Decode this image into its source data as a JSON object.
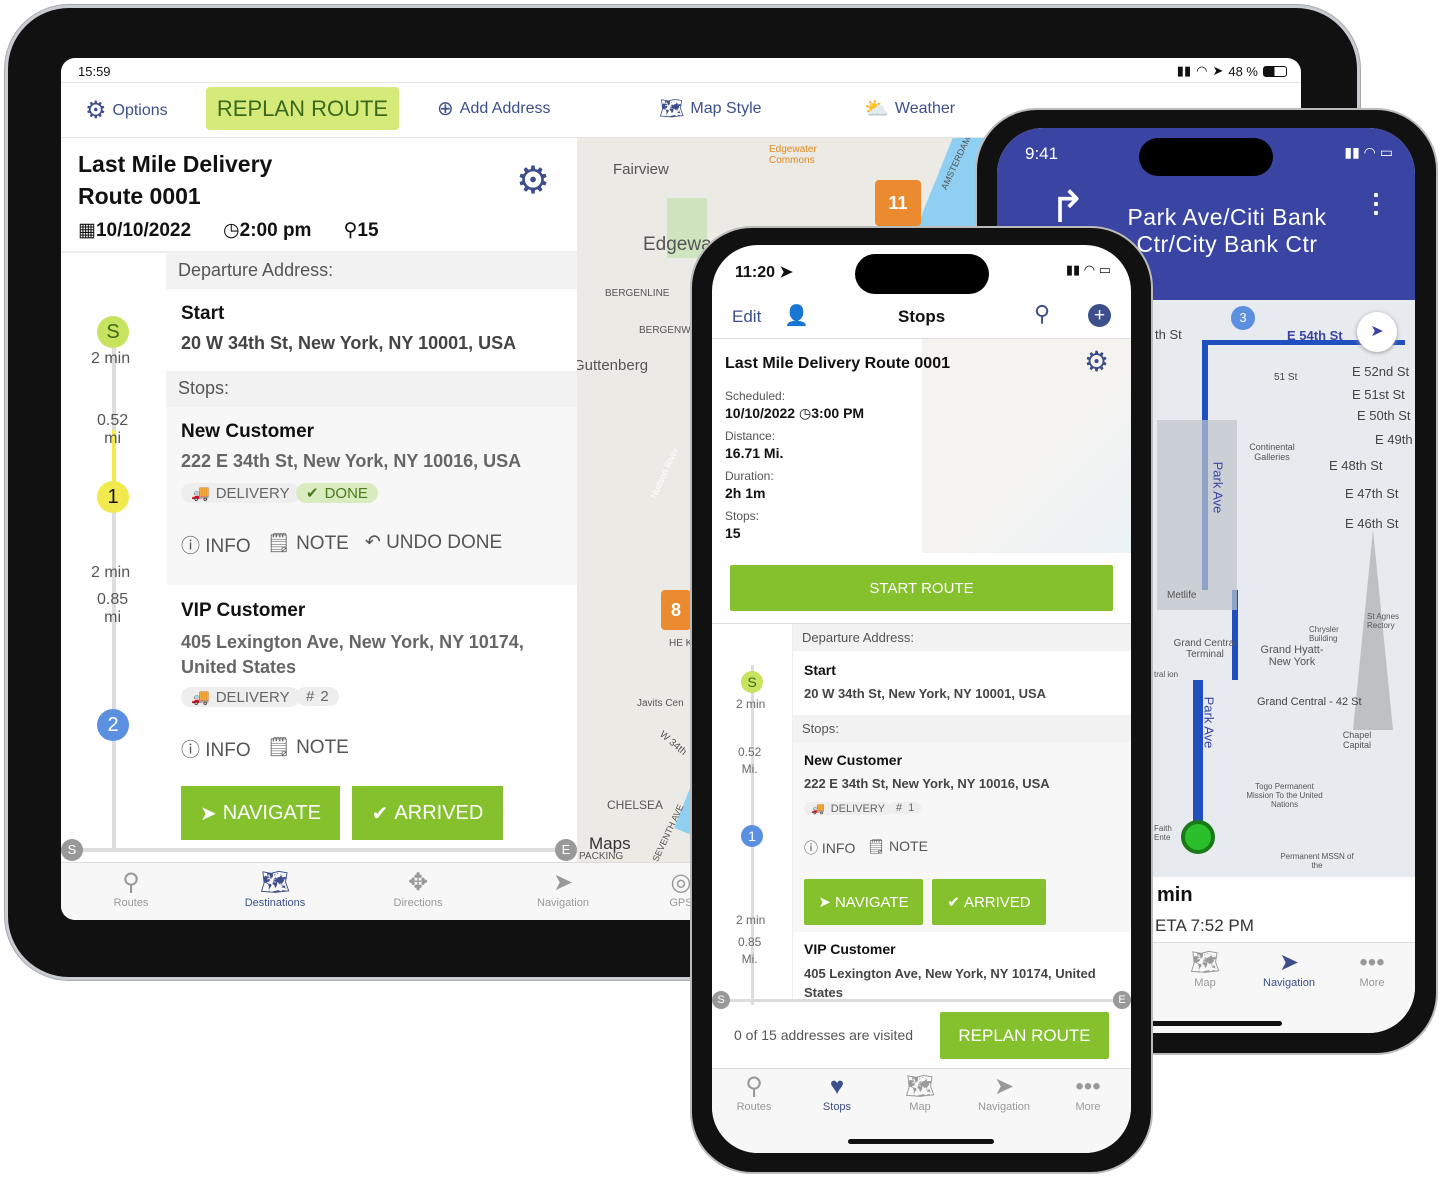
{
  "tablet": {
    "status": {
      "time": "15:59",
      "battery": "48 %"
    },
    "toolbar": {
      "options": "Options",
      "replan": "REPLAN ROUTE",
      "add_address": "Add Address",
      "map_style": "Map Style",
      "weather": "Weather"
    },
    "route": {
      "title_line1": "Last Mile Delivery",
      "title_line2": "Route 0001",
      "date": "10/10/2022",
      "time": "2:00 pm",
      "stops": "15"
    },
    "departure_header": "Departure Address:",
    "start": {
      "label": "Start",
      "address": "20 W 34th St, New York, NY 10001, USA",
      "marker": "S",
      "eta": "2 min"
    },
    "stops_header": "Stops:",
    "timeline": {
      "d1": "0.52",
      "u1": "mi",
      "t2": "2 min",
      "d2": "0.85",
      "u2": "mi",
      "start_cap": "S",
      "end_cap": "E"
    },
    "stop1": {
      "marker": "1",
      "name": "New Customer",
      "address": "222 E 34th St, New York, NY 10016, USA",
      "badge1": "DELIVERY",
      "badge2": "DONE",
      "info": "INFO",
      "note": "NOTE",
      "undo": "UNDO DONE"
    },
    "stop2": {
      "marker": "2",
      "name": "VIP Customer",
      "address": "405 Lexington Ave, New York, NY 10174, United States",
      "badge1": "DELIVERY",
      "badge2": "2",
      "info": "INFO",
      "note": "NOTE",
      "navigate": "NAVIGATE",
      "arrived": "ARRIVED"
    },
    "map": {
      "labels": [
        "Fairview",
        "Edgewa",
        "BERGENLINE",
        "BERGENW",
        "Guttenberg",
        "Edgewater Commons",
        "Hudson River",
        "CHELSEA",
        "Javits Cen",
        "W 34th",
        "AMSTERDAM",
        "SEVENTH AVE",
        "PACKING",
        "HE KITC"
      ],
      "pins": [
        "11",
        "8"
      ],
      "attribution": "Maps"
    },
    "tabs": [
      "Routes",
      "Destinations",
      "Directions",
      "Navigation",
      "GPS"
    ],
    "active_tab": "Destinations"
  },
  "back_phone": {
    "status": {
      "time": "9:41"
    },
    "instruction": "Park Ave/Citi Bank Ctr/City Bank Ctr",
    "map": {
      "route_pin": "3",
      "streets": [
        "E 54th St",
        "E 52nd St",
        "E 51st St",
        "E 50th St",
        "E 49th",
        "E 48th St",
        "E 47th St",
        "E 46th St",
        "Park Ave",
        "Park Ave",
        "th St"
      ],
      "places": [
        "51 St",
        "Continental Galleries",
        "Metlife",
        "Grand Central Terminal",
        "Grand Hyatt-New York",
        "Chrysler Building",
        "St Agnes Rectory",
        "Grand Central - 42 St",
        "Chapel Capital",
        "Togo Permanent Mission To the United Nations",
        "Permanent MSSN of the",
        "Faith Ente",
        "tral ion"
      ]
    },
    "eta": {
      "duration": "min",
      "eta": "ETA 7:52 PM"
    },
    "tabs": [
      "Map",
      "Navigation",
      "More"
    ],
    "active_tab": "Navigation",
    "accent": "#3a45a3"
  },
  "front_phone": {
    "status": {
      "time": "11:20"
    },
    "nav": {
      "edit": "Edit",
      "title": "Stops"
    },
    "route": {
      "title": "Last Mile Delivery Route 0001",
      "scheduled_label": "Scheduled:",
      "date": "10/10/2022",
      "time": "3:00 PM",
      "distance_label": "Distance:",
      "distance": "16.71 Mi.",
      "duration_label": "Duration:",
      "duration": "2h 1m",
      "stops_label": "Stops:",
      "stops": "15"
    },
    "start_route": "START ROUTE",
    "departure_header": "Departure Address:",
    "start": {
      "label": "Start",
      "address": "20 W 34th St, New York, NY 10001, USA",
      "marker": "S",
      "eta": "2 min"
    },
    "stops_header": "Stops:",
    "timeline": {
      "d1": "0.52",
      "u1": "Mi.",
      "t2": "2 min",
      "d2": "0.85",
      "u2": "Mi.",
      "start_cap": "S",
      "end_cap": "E"
    },
    "stop1": {
      "marker": "1",
      "name": "New Customer",
      "address": "222 E 34th St, New York, NY 10016, USA",
      "badge1": "DELIVERY",
      "badge2": "1",
      "info": "INFO",
      "note": "NOTE",
      "navigate": "NAVIGATE",
      "arrived": "ARRIVED"
    },
    "stop2": {
      "name": "VIP Customer",
      "address": "405 Lexington Ave, New York, NY 10174, United States"
    },
    "footer": {
      "visited": "0 of 15 addresses are visited",
      "replan": "REPLAN ROUTE"
    },
    "tabs": [
      "Routes",
      "Stops",
      "Map",
      "Navigation",
      "More"
    ],
    "active_tab": "Stops"
  },
  "colors": {
    "green": "#84c12d",
    "replan_bg": "#d6ea7a",
    "navy": "#3d4f8a",
    "pin_orange": "#ec8a2f",
    "blue_marker": "#5b8fe0",
    "yellow_marker": "#f2e94e"
  }
}
